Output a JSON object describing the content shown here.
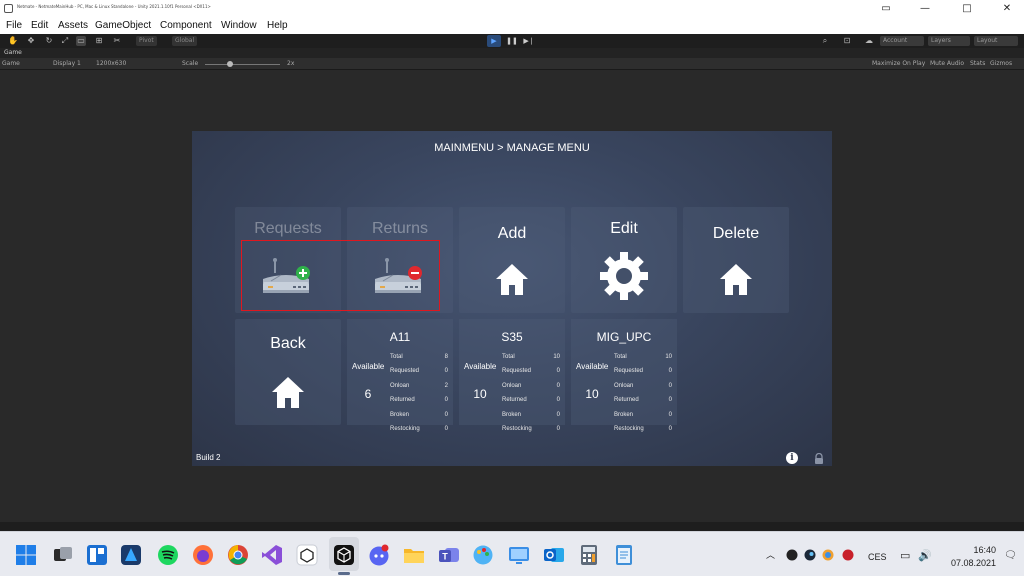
{
  "window": {
    "title": "Netmate - NetmateMainHub - PC, Mac & Linux Standalone - Unity 2021.1.10f1 Personal <DX11>",
    "controls": [
      "▭",
      "—",
      "□",
      "✕"
    ]
  },
  "menu": [
    "File",
    "Edit",
    "Assets",
    "GameObject",
    "Component",
    "Window",
    "Help"
  ],
  "toolbar": {
    "pivot": "Pivot",
    "global": "Global",
    "account": "Account",
    "layers": "Layers",
    "layout": "Layout"
  },
  "game_tab": {
    "tab": "Game",
    "view": "Game",
    "display": "Display 1",
    "resolution": "1200x630",
    "scale_label": "Scale",
    "scale_value": "2x",
    "maximize": "Maximize On Play",
    "mute": "Mute Audio",
    "stats": "Stats",
    "gizmos": "Gizmos"
  },
  "screen": {
    "breadcrumb": "MAINMENU > MANAGE MENU",
    "tiles": {
      "requests": "Requests",
      "returns": "Returns",
      "add": "Add",
      "edit": "Edit",
      "delete": "Delete",
      "back": "Back"
    },
    "stats": [
      {
        "name": "A11",
        "available_label": "Available",
        "available": "6",
        "rows": [
          {
            "label": "Total",
            "value": "8"
          },
          {
            "label": "Requested",
            "value": "0"
          },
          {
            "label": "Onloan",
            "value": "2"
          },
          {
            "label": "Returned",
            "value": "0"
          },
          {
            "label": "Broken",
            "value": "0"
          },
          {
            "label": "Restocking",
            "value": "0"
          }
        ]
      },
      {
        "name": "S35",
        "available_label": "Available",
        "available": "10",
        "rows": [
          {
            "label": "Total",
            "value": "10"
          },
          {
            "label": "Requested",
            "value": "0"
          },
          {
            "label": "Onloan",
            "value": "0"
          },
          {
            "label": "Returned",
            "value": "0"
          },
          {
            "label": "Broken",
            "value": "0"
          },
          {
            "label": "Restocking",
            "value": "0"
          }
        ]
      },
      {
        "name": "MIG_UPC",
        "available_label": "Available",
        "available": "10",
        "rows": [
          {
            "label": "Total",
            "value": "10"
          },
          {
            "label": "Requested",
            "value": "0"
          },
          {
            "label": "Onloan",
            "value": "0"
          },
          {
            "label": "Returned",
            "value": "0"
          },
          {
            "label": "Broken",
            "value": "0"
          },
          {
            "label": "Restocking",
            "value": "0"
          }
        ]
      }
    ],
    "build": "Build 2",
    "info": "i"
  },
  "tray": {
    "lang": "CES",
    "time": "16:40",
    "date": "07.08.2021"
  },
  "colors": {
    "highlight": "#e0171f",
    "add_badge": "#2fb24a",
    "remove_badge": "#e0282e",
    "play_active": "#5ea4ff"
  }
}
